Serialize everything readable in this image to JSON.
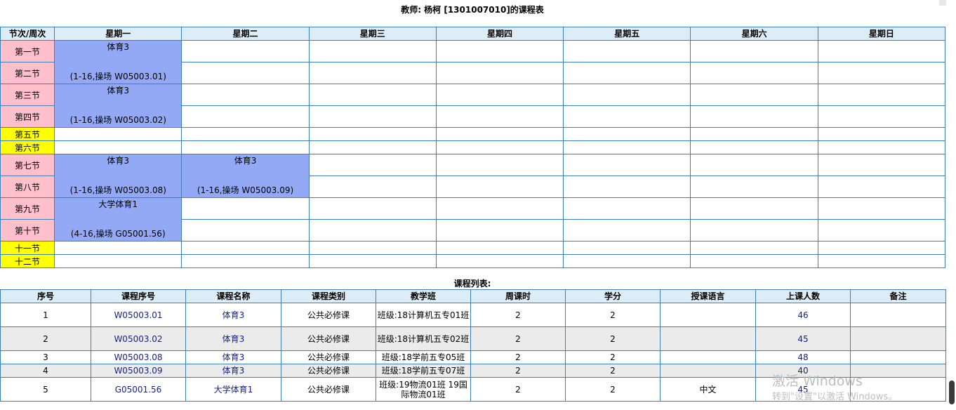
{
  "page_title": "教师: 杨柯 [1301007010]的课程表",
  "schedule": {
    "corner_header": "节次/周次",
    "days": [
      "星期一",
      "星期二",
      "星期三",
      "星期四",
      "星期五",
      "星期六",
      "星期日"
    ],
    "periods": [
      "第一节",
      "第二节",
      "第三节",
      "第四节",
      "第五节",
      "第六节",
      "第七节",
      "第八节",
      "第九节",
      "第十节",
      "十一节",
      "十二节"
    ],
    "courses": [
      {
        "name": "体育3",
        "info": "(1-16,操场 W05003.01)"
      },
      {
        "name": "体育3",
        "info": "(1-16,操场 W05003.02)"
      },
      {
        "name": "体育3",
        "info": "(1-16,操场 W05003.08)"
      },
      {
        "name": "体育3",
        "info": "(1-16,操场 W05003.09)"
      },
      {
        "name": "大学体育1",
        "info": "(4-16,操场 G05001.56)"
      }
    ]
  },
  "course_list": {
    "title": "课程列表:",
    "headers": [
      "序号",
      "课程序号",
      "课程名称",
      "课程类别",
      "教学班",
      "周课时",
      "学分",
      "授课语言",
      "上课人数",
      "备注"
    ],
    "rows": [
      {
        "no": "1",
        "code": "W05003.01",
        "name": "体育3",
        "type": "公共必修课",
        "class": "班级:18计算机五专01班",
        "hours": "2",
        "credit": "2",
        "lang": "",
        "count": "46",
        "note": ""
      },
      {
        "no": "2",
        "code": "W05003.02",
        "name": "体育3",
        "type": "公共必修课",
        "class": "班级:18计算机五专02班",
        "hours": "2",
        "credit": "2",
        "lang": "",
        "count": "45",
        "note": ""
      },
      {
        "no": "3",
        "code": "W05003.08",
        "name": "体育3",
        "type": "公共必修课",
        "class": "班级:18学前五专05班",
        "hours": "2",
        "credit": "2",
        "lang": "",
        "count": "48",
        "note": ""
      },
      {
        "no": "4",
        "code": "W05003.09",
        "name": "体育3",
        "type": "公共必修课",
        "class": "班级:18学前五专07班",
        "hours": "2",
        "credit": "2",
        "lang": "",
        "count": "40",
        "note": ""
      },
      {
        "no": "5",
        "code": "G05001.56",
        "name": "大学体育1",
        "type": "公共必修课",
        "class": "班级:19物流01班 19国际物流01班",
        "hours": "2",
        "credit": "2",
        "lang": "中文",
        "count": "45",
        "note": ""
      }
    ]
  },
  "watermark": {
    "line1": "激活 Windows",
    "line2": "转到\"设置\"以激活 Windows。"
  },
  "colors": {
    "header_bg": "#ddedf8",
    "course_bg": "#93a9f5",
    "period_pink": "#ffc0cb",
    "period_yellow": "#ffff00",
    "border": "#3f7fb5",
    "link": "#1a237e"
  }
}
